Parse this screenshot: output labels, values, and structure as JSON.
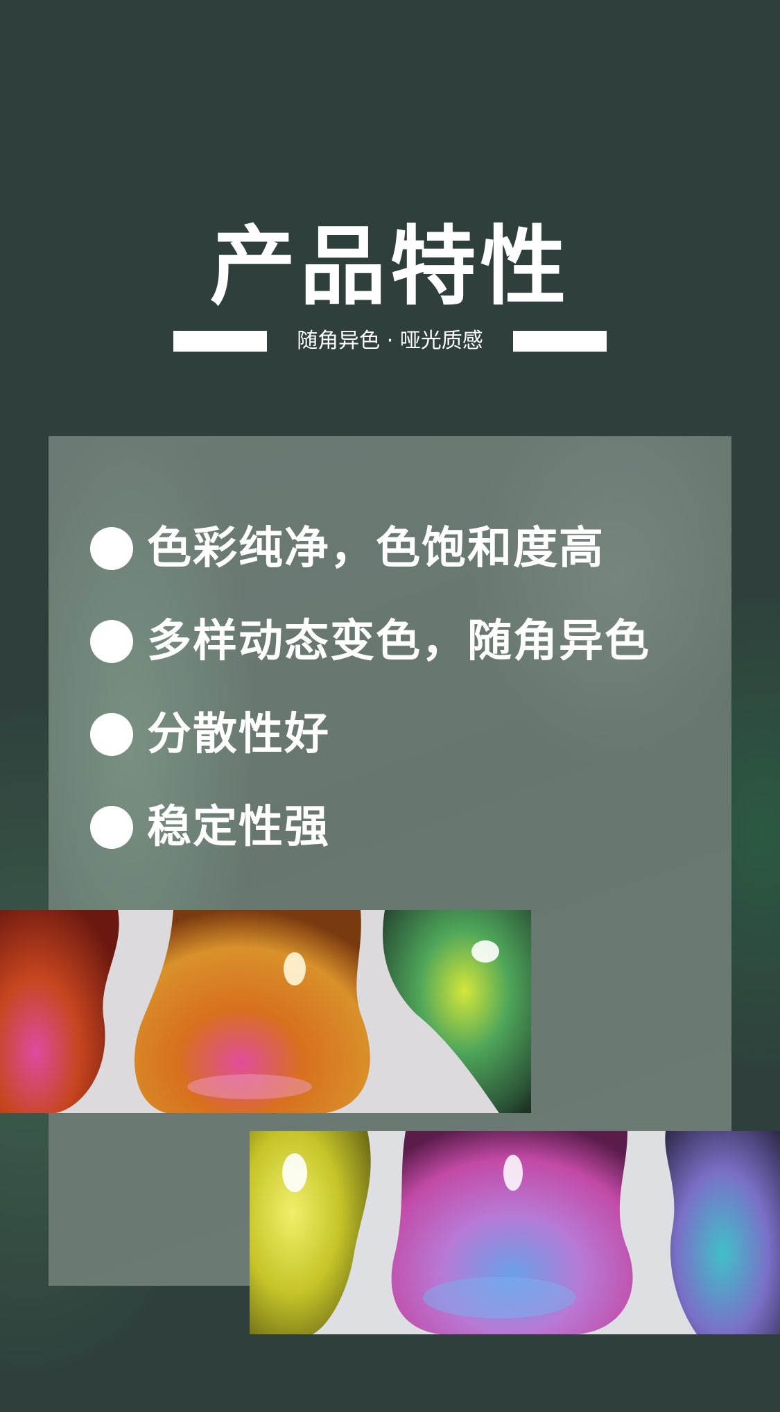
{
  "header": {
    "title": "产品特性",
    "subtitle": "随角异色 · 哑光质感"
  },
  "features": [
    {
      "label": "色彩纯净，色饱和度高"
    },
    {
      "label": "多样动态变色，随角异色"
    },
    {
      "label": "分散性好"
    },
    {
      "label": "稳定性强"
    }
  ],
  "colors": {
    "background": "#2f403c",
    "panel": "#6b7a74",
    "text": "#ffffff"
  }
}
